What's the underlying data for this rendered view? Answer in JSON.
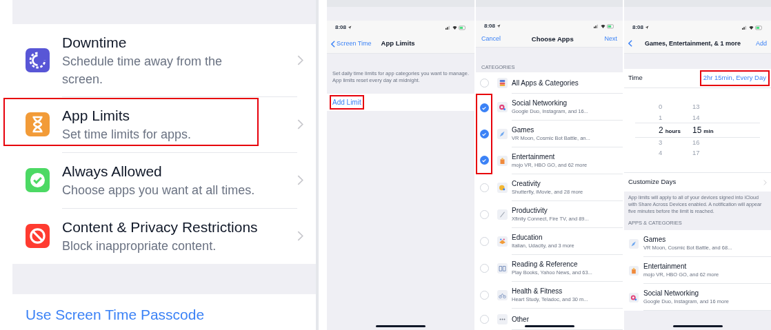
{
  "settings_screen": {
    "items": [
      {
        "kind": "downtime",
        "title": "Downtime",
        "subtitle": "Schedule time away from the screen.",
        "highlighted": false
      },
      {
        "kind": "limits",
        "title": "App Limits",
        "subtitle": "Set time limits for apps.",
        "highlighted": true
      },
      {
        "kind": "allowed",
        "title": "Always Allowed",
        "subtitle": "Choose apps you want at all times.",
        "highlighted": false
      },
      {
        "kind": "restrictions",
        "title": "Content & Privacy Restrictions",
        "subtitle": "Block inappropriate content.",
        "highlighted": false
      }
    ],
    "passcode_link": "Use Screen Time Passcode"
  },
  "app_limits_screen": {
    "status_time": "8:08",
    "back": "Screen Time",
    "title": "App Limits",
    "description": "Set daily time limits for app categories you want to manage. App limits reset every day at midnight.",
    "add_limit": {
      "label": "Add Limit",
      "highlighted": true
    }
  },
  "choose_apps_screen": {
    "status_time": "8:08",
    "cancel": "Cancel",
    "title": "Choose Apps",
    "next": "Next",
    "section_header": "CATEGORIES",
    "categories": [
      {
        "kind": "all",
        "title": "All Apps & Categories",
        "checked": false,
        "highlighted": false
      },
      {
        "kind": "social",
        "title": "Social Networking",
        "subtitle": "Google Duo, Instagram, and 16...",
        "checked": true,
        "highlighted": true
      },
      {
        "kind": "games",
        "title": "Games",
        "subtitle": "VR Moon, Cosmic Bot Battle, an...",
        "checked": true,
        "highlighted": true
      },
      {
        "kind": "entertainment",
        "title": "Entertainment",
        "subtitle": "mojo VR, HBO GO, and 62 more",
        "checked": true,
        "highlighted": true
      },
      {
        "kind": "creativity",
        "title": "Creativity",
        "subtitle": "Shutterfly, iMovie, and 28 more",
        "checked": false,
        "highlighted": false
      },
      {
        "kind": "productivity",
        "title": "Productivity",
        "subtitle": "Xfinity Connect, Fire TV, and 89...",
        "checked": false,
        "highlighted": false
      },
      {
        "kind": "education",
        "title": "Education",
        "subtitle": "Italian, Udacity, and 3 more",
        "checked": false,
        "highlighted": false
      },
      {
        "kind": "reading",
        "title": "Reading & Reference",
        "subtitle": "Play Books, Yahoo News, and 63...",
        "checked": false,
        "highlighted": false
      },
      {
        "kind": "health",
        "title": "Health & Fitness",
        "subtitle": "Heart Study, Teladoc, and 30 m...",
        "checked": false,
        "highlighted": false
      },
      {
        "kind": "other",
        "title": "Other",
        "checked": false,
        "highlighted": false
      }
    ]
  },
  "limit_detail_screen": {
    "status_time": "8:08",
    "title": "Games, Entertainment, & 1 more",
    "add": "Add",
    "time_label": "Time",
    "time_value": {
      "text": "2hr 15min, Every Day",
      "highlighted": true
    },
    "picker": {
      "rows": [
        {
          "hour": "0",
          "minute": "13",
          "selected": false
        },
        {
          "hour": "1",
          "minute": "14",
          "selected": false
        },
        {
          "hour": "2",
          "minute": "15",
          "selected": true
        },
        {
          "hour": "3",
          "minute": "16",
          "selected": false
        },
        {
          "hour": "4",
          "minute": "17",
          "selected": false
        }
      ],
      "hours_unit": "hours",
      "minutes_unit": "min"
    },
    "customize_days": "Customize Days",
    "note": "App limits will apply to all of your devices signed into iCloud with Share Across Devices enabled. A notification will appear five minutes before the limit is reached.",
    "section_header": "APPS & CATEGORIES",
    "apps": [
      {
        "kind": "games",
        "title": "Games",
        "subtitle": "VR Moon, Cosmic Bot Battle, and 68..."
      },
      {
        "kind": "entertainment",
        "title": "Entertainment",
        "subtitle": "mojo VR, HBO GO, and 62 more"
      },
      {
        "kind": "social",
        "title": "Social Networking",
        "subtitle": "Google Duo, Instagram, and 16 more"
      }
    ]
  }
}
